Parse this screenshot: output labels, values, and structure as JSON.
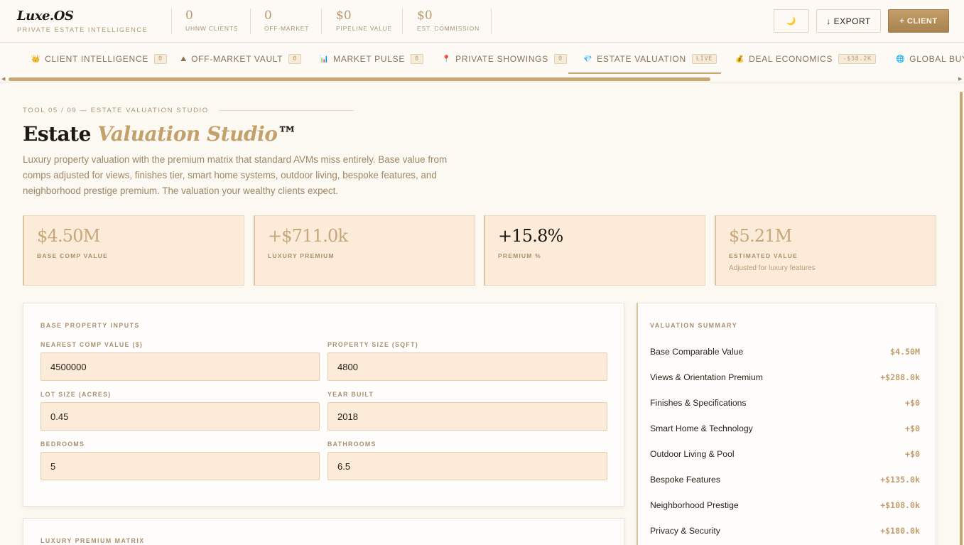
{
  "brand": {
    "logo": "Luxe.OS",
    "tagline": "PRIVATE ESTATE INTELLIGENCE"
  },
  "header_stats": [
    {
      "value": "0",
      "label": "UHNW CLIENTS"
    },
    {
      "value": "0",
      "label": "OFF-MARKET"
    },
    {
      "value": "$0",
      "label": "PIPELINE VALUE"
    },
    {
      "value": "$0",
      "label": "EST. COMMISSION"
    }
  ],
  "header_buttons": {
    "theme_icon": "moon-icon",
    "theme_glyph": "🌙",
    "export": "↓ EXPORT",
    "client": "+ CLIENT"
  },
  "tabs": [
    {
      "icon": "crown-icon",
      "glyph": "👑",
      "label": "CLIENT INTELLIGENCE",
      "badge": "0"
    },
    {
      "icon": "vault-icon",
      "glyph": "⛰",
      "label": "OFF-MARKET VAULT",
      "badge": "0"
    },
    {
      "icon": "chart-icon",
      "glyph": "📊",
      "label": "MARKET PULSE",
      "badge": "0"
    },
    {
      "icon": "pin-icon",
      "glyph": "📍",
      "label": "PRIVATE SHOWINGS",
      "badge": "0"
    },
    {
      "icon": "gem-icon",
      "glyph": "💎",
      "label": "ESTATE VALUATION",
      "badge": "LIVE"
    },
    {
      "icon": "money-bag-icon",
      "glyph": "💰",
      "label": "DEAL ECONOMICS",
      "badge": "-$38.2K"
    },
    {
      "icon": "globe-icon",
      "glyph": "🌐",
      "label": "GLOBAL BUYE",
      "badge": ""
    }
  ],
  "page": {
    "eyebrow": "TOOL 05 / 09 — ESTATE VALUATION STUDIO",
    "title_plain": "Estate ",
    "title_em": "Valuation Studio",
    "title_tm": "™",
    "description": "Luxury property valuation with the premium matrix that standard AVMs miss entirely. Base value from comps adjusted for views, finishes tier, smart home systems, outdoor living, bespoke features, and neighborhood prestige premium. The valuation your wealthy clients expect."
  },
  "kpis": [
    {
      "value": "$4.50M",
      "label": "BASE COMP VALUE",
      "sub": ""
    },
    {
      "value": "+$711.0k",
      "label": "LUXURY PREMIUM",
      "sub": ""
    },
    {
      "value": "+15.8%",
      "label": "PREMIUM %",
      "sub": ""
    },
    {
      "value": "$5.21M",
      "label": "ESTIMATED VALUE",
      "sub": "Adjusted for luxury features"
    }
  ],
  "inputs_panel": {
    "title": "BASE PROPERTY INPUTS",
    "fields": [
      {
        "label": "NEAREST COMP VALUE ($)",
        "value": "4500000"
      },
      {
        "label": "PROPERTY SIZE (SQFT)",
        "value": "4800"
      },
      {
        "label": "LOT SIZE (ACRES)",
        "value": "0.45"
      },
      {
        "label": "YEAR BUILT",
        "value": "2018"
      },
      {
        "label": "BEDROOMS",
        "value": "5"
      },
      {
        "label": "BATHROOMS",
        "value": "6.5"
      }
    ]
  },
  "matrix_panel": {
    "title": "LUXURY PREMIUM MATRIX"
  },
  "summary": {
    "title": "VALUATION SUMMARY",
    "rows": [
      {
        "label": "Base Comparable Value",
        "value": "$4.50M"
      },
      {
        "label": "Views & Orientation Premium",
        "value": "+$288.0k"
      },
      {
        "label": "Finishes & Specifications",
        "value": "+$0"
      },
      {
        "label": "Smart Home & Technology",
        "value": "+$0"
      },
      {
        "label": "Outdoor Living & Pool",
        "value": "+$0"
      },
      {
        "label": "Bespoke Features",
        "value": "+$135.0k"
      },
      {
        "label": "Neighborhood Prestige",
        "value": "+$108.0k"
      },
      {
        "label": "Privacy & Security",
        "value": "+$180.0k"
      }
    ]
  },
  "colors": {
    "accent": "#c4a06a",
    "background": "#fcf8f2",
    "kpi_fill": "#fbebd8",
    "text": "#1e1812"
  }
}
